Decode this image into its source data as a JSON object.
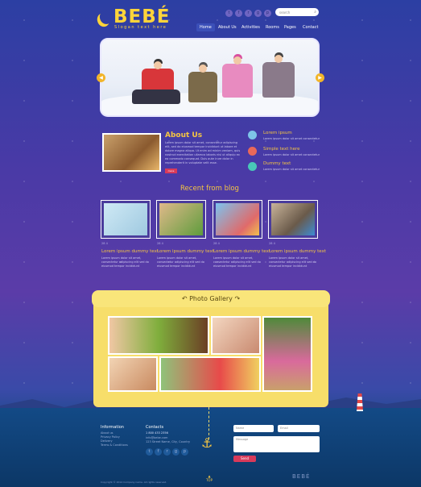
{
  "brand": {
    "name": "BEBÉ",
    "slogan": "Slogan text here"
  },
  "header": {
    "social_icons": [
      "twitter-icon",
      "facebook-icon",
      "rss-icon",
      "google-plus-icon",
      "pinterest-icon",
      "skype-icon"
    ],
    "social_glyphs": [
      "t",
      "f",
      "r",
      "g",
      "p",
      "s"
    ],
    "search_placeholder": "search",
    "nav": [
      "Home",
      "About Us",
      "Activities",
      "Rooms",
      "Pages",
      "Contact"
    ]
  },
  "about": {
    "title": "About Us",
    "text": "Lorem ipsum dolor sit amet, consectetur adipiscing elit, sed do eiusmod tempor incididunt ut labore et dolore magna aliqua. Ut enim ad minim veniam, quis nostrud exercitation ullamco laboris nisi ut aliquip ex ea commodo consequat. Duis aute irure dolor in reprehenderit in voluptate velit esse.",
    "more": "more"
  },
  "features": [
    {
      "title": "Lorem ipsum",
      "text": "Lorem ipsum dolor sit amet consectetur",
      "icon": "plane-icon",
      "color": "#7ec4e8"
    },
    {
      "title": "Simple text here",
      "text": "Lorem ipsum dolor sit amet consectetur",
      "icon": "lifebuoy-icon",
      "color": "#e9685a"
    },
    {
      "title": "Dummy text",
      "text": "Lorem ipsum dolor sit amet consectetur",
      "icon": "arrow-icon",
      "color": "#49c6b8"
    }
  ],
  "blog": {
    "title": "Recent from blog",
    "posts": [
      {
        "meta": "28   4",
        "title": "Lorem ipsum dummy text",
        "text": "Lorem ipsum dolor sit amet, consectetur adipiscing elit sed do eiusmod tempor incididunt"
      },
      {
        "meta": "28   4",
        "title": "Lorem ipsum dummy text",
        "text": "Lorem ipsum dolor sit amet, consectetur adipiscing elit sed do eiusmod tempor incididunt"
      },
      {
        "meta": "28   4",
        "title": "Lorem ipsum dummy text",
        "text": "Lorem ipsum dolor sit amet, consectetur adipiscing elit sed do eiusmod tempor incididunt"
      },
      {
        "meta": "28   4",
        "title": "Lorem ipsum dummy text",
        "text": "Lorem ipsum dolor sit amet, consectetur adipiscing elit sed do eiusmod tempor incididunt"
      }
    ]
  },
  "gallery": {
    "title": "Photo Gallery"
  },
  "footer": {
    "info_title": "Information",
    "info_items": [
      "About us",
      "Privacy Policy",
      "Delivery",
      "Terms & Conditions"
    ],
    "contacts_title": "Contacts",
    "phone": "1 800 433 2356",
    "contact_lines": [
      "info@bebe.com",
      "123 Street Name, City, Country"
    ],
    "name_placeholder": "Name",
    "email_placeholder": "Email",
    "message_placeholder": "Message",
    "send": "Send",
    "copyright": "Copyright © 2014 Company name. All rights reserved.",
    "brand": "BEBÉ",
    "top": "TOP"
  }
}
